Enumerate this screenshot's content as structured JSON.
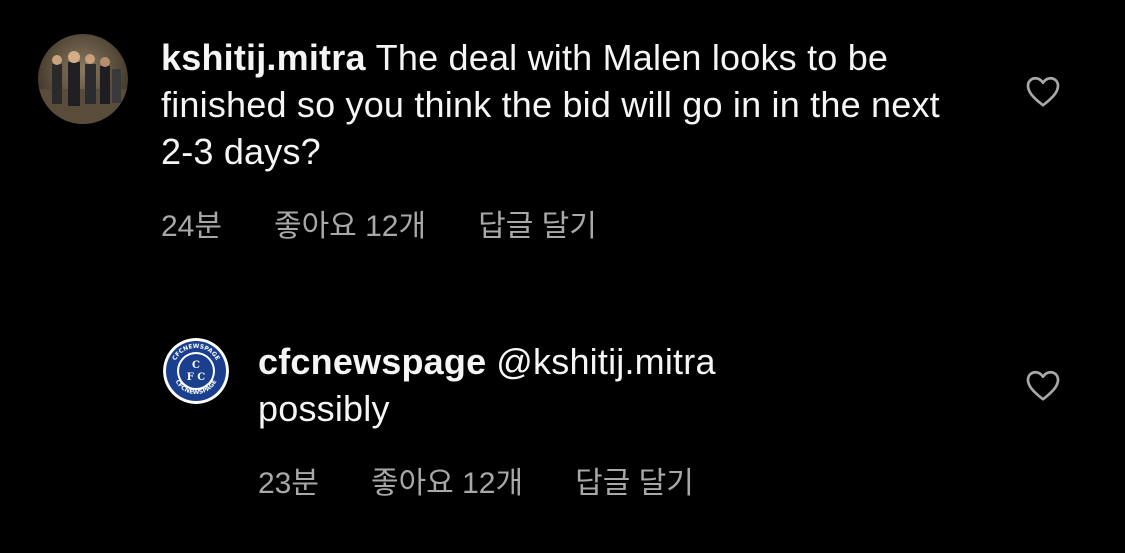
{
  "comments": [
    {
      "username": "kshitij.mitra",
      "mention": "",
      "text": "The deal with Malen looks to be finished so you think the bid will go in in the next 2-3 days?",
      "time": "24분",
      "likes": "좋아요 12개",
      "reply": "답글 달기",
      "avatar_icon": "user-photo-avatar"
    },
    {
      "username": "cfcnewspage",
      "mention": "@kshitij.mitra",
      "text": "possibly",
      "time": "23분",
      "likes": "좋아요 12개",
      "reply": "답글 달기",
      "avatar_icon": "chelsea-crest-avatar"
    }
  ],
  "colors": {
    "background": "#000000",
    "text": "#f5f5f5",
    "meta": "#a8a8a8",
    "crest_blue": "#1b3f8f"
  }
}
